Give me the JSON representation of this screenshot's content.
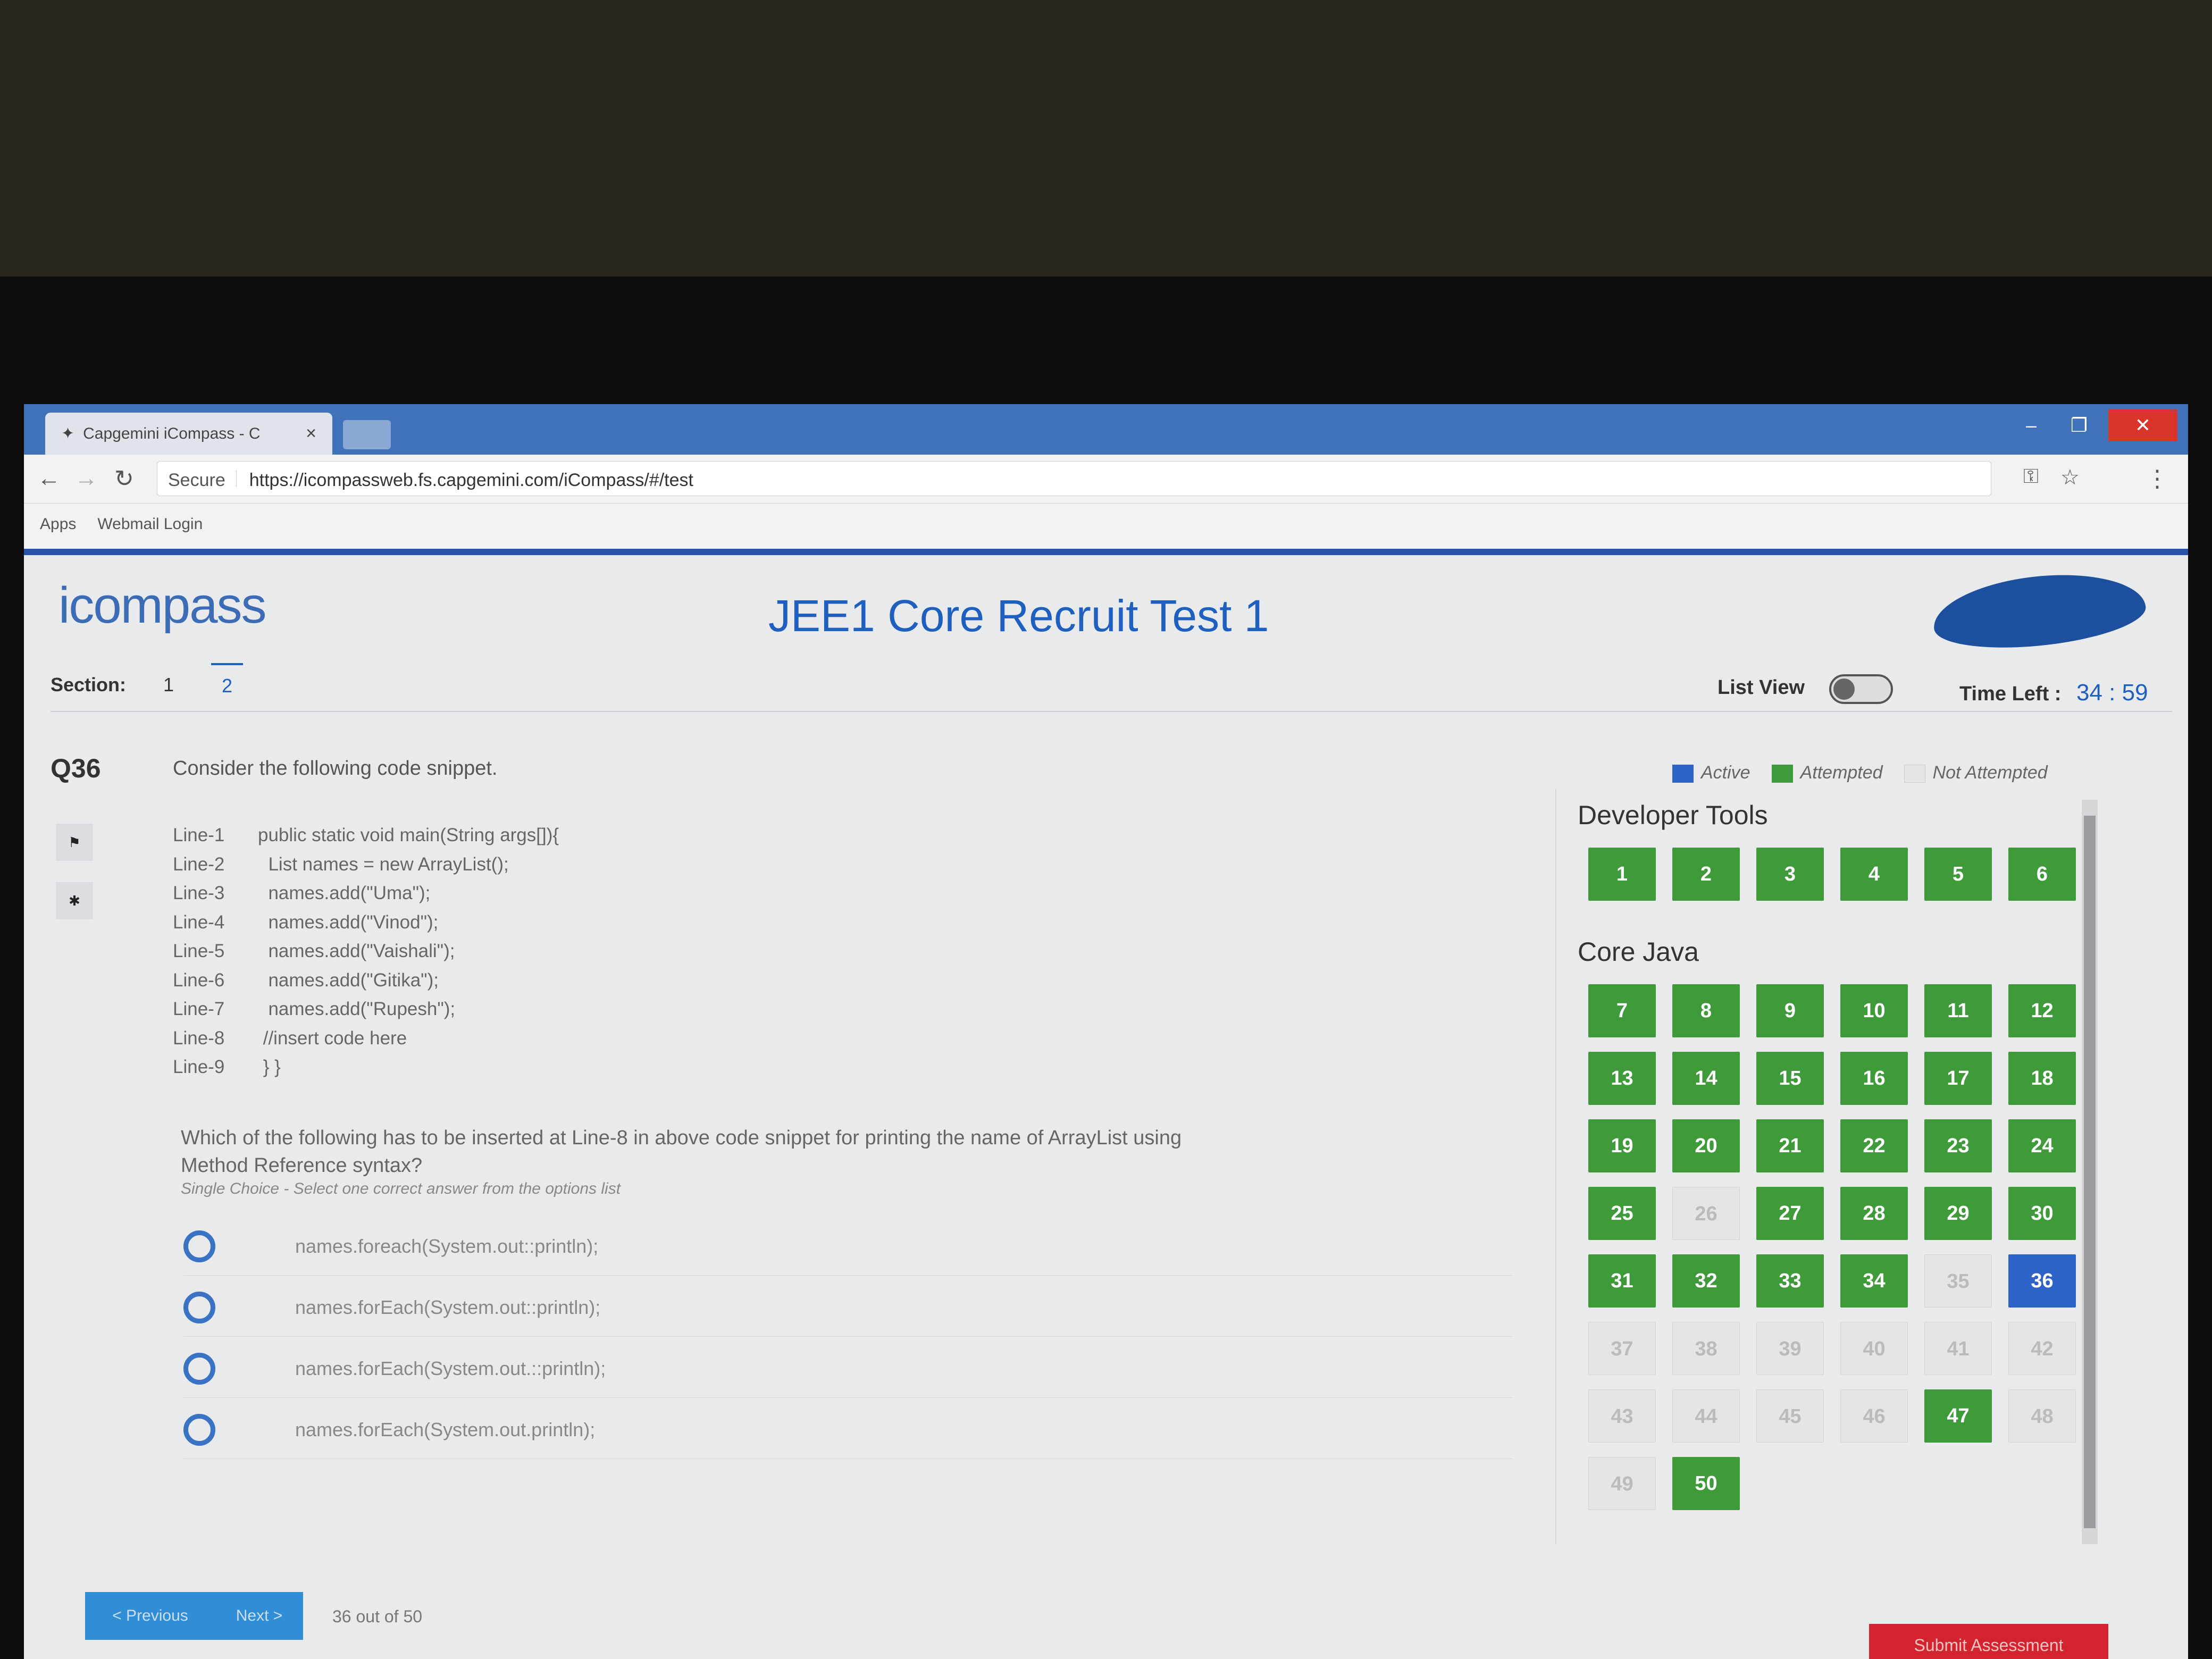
{
  "browser": {
    "tab_title": "Capgemini iCompass - C",
    "tab_close": "×",
    "secure_label": "Secure",
    "url": "https://icompassweb.fs.capgemini.com/iCompass/#/test",
    "bookmarks": [
      "Apps",
      "Webmail Login"
    ],
    "window_controls": [
      "–",
      "❐",
      "✕"
    ]
  },
  "header": {
    "logo": "icompass",
    "title": "JEE1 Core Recruit Test 1",
    "section_label": "Section:",
    "sections": [
      "1",
      "2"
    ],
    "list_view_label": "List View",
    "time_left_label": "Time Left :",
    "time_left": "34 : 59"
  },
  "question": {
    "number": "Q36",
    "intro": "Consider the following code snippet.",
    "code": [
      {
        "line": "Line-1",
        "text": "public static void main(String args[]){"
      },
      {
        "line": "Line-2",
        "text": "  List names = new ArrayList();"
      },
      {
        "line": "Line-3",
        "text": "  names.add(\"Uma\");"
      },
      {
        "line": "Line-4",
        "text": "  names.add(\"Vinod\");"
      },
      {
        "line": "Line-5",
        "text": "  names.add(\"Vaishali\");"
      },
      {
        "line": "Line-6",
        "text": "  names.add(\"Gitika\");"
      },
      {
        "line": "Line-7",
        "text": "  names.add(\"Rupesh\");"
      },
      {
        "line": "Line-8",
        "text": " //insert code here"
      },
      {
        "line": "Line-9",
        "text": " } }"
      }
    ],
    "text": "Which of the following has to be inserted at Line-8 in above code snippet for printing the name of ArrayList using Method Reference syntax?",
    "hint": "Single Choice - Select one correct answer from the options list",
    "options": [
      "names.foreach(System.out::println);",
      "names.forEach(System.out::println);",
      "names.forEach(System.out.::println);",
      "names.forEach(System.out.println);"
    ]
  },
  "legend": {
    "active": "Active",
    "attempted": "Attempted",
    "not_attempted": "Not Attempted"
  },
  "colors": {
    "active": "#2d63c8",
    "attempted": "#3f9a3a",
    "not_attempted": "#e4e5e7",
    "accent": "#1f5fc0"
  },
  "groups": [
    {
      "name": "Developer Tools",
      "questions": [
        1,
        2,
        3,
        4,
        5,
        6
      ]
    },
    {
      "name": "Core Java",
      "questions": [
        7,
        8,
        9,
        10,
        11,
        12,
        13,
        14,
        15,
        16,
        17,
        18,
        19,
        20,
        21,
        22,
        23,
        24,
        25,
        26,
        27,
        28,
        29,
        30,
        31,
        32,
        33,
        34,
        35,
        36,
        37,
        38,
        39,
        40,
        41,
        42,
        43,
        44,
        45,
        46,
        47,
        48,
        49,
        50
      ]
    }
  ],
  "active_question": 36,
  "not_attempted": [
    26,
    35,
    37,
    38,
    39,
    40,
    41,
    42,
    43,
    44,
    45,
    46,
    48,
    49
  ],
  "footer": {
    "previous": "< Previous",
    "next": "Next >",
    "progress": "36 out of 50",
    "submit": "Submit Assessment"
  }
}
